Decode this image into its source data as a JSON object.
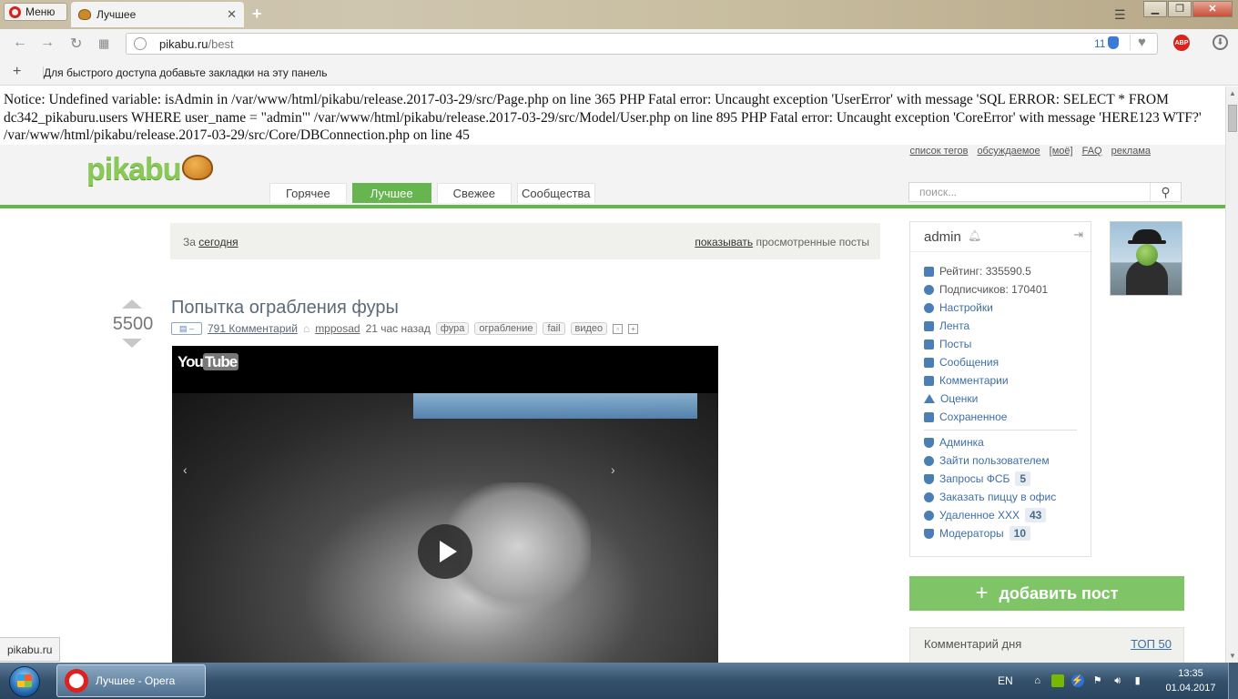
{
  "browser": {
    "menu_label": "Меню",
    "tab_title": "Лучшее",
    "tab_close": "✕",
    "new_tab": "+",
    "url_host": "pikabu.ru",
    "url_path": "/best",
    "blocked_count": "11",
    "bookmarks_plus": "+",
    "bookmarks_hint": "Для быстрого доступа добавьте закладки на эту панель",
    "abp_label": "ABP"
  },
  "error_text": "Notice: Undefined variable: isAdmin in /var/www/html/pikabu/release.2017-03-29/src/Page.php on line 365 PHP Fatal error: Uncaught exception 'UserError' with message 'SQL ERROR: SELECT * FROM dc342_pikaburu.users WHERE user_name = \"admin\"' /var/www/html/pikabu/release.2017-03-29/src/Model/User.php on line 895 PHP Fatal error: Uncaught exception 'CoreError' with message 'HERE123 WTF?' /var/www/html/pikabu/release.2017-03-29/src/Core/DBConnection.php on line 45",
  "header": {
    "logo": "pikabu",
    "top_links": [
      "список тегов",
      "обсуждаемое",
      "[моё]",
      "FAQ",
      "реклама"
    ],
    "tabs": [
      {
        "label": "Горячее",
        "active": false
      },
      {
        "label": "Лучшее",
        "active": true
      },
      {
        "label": "Свежее",
        "active": false
      },
      {
        "label": "Сообщества",
        "active": false
      }
    ],
    "search_placeholder": "поиск..."
  },
  "filter": {
    "prefix": "За",
    "period": "сегодня",
    "show_link": "показывать",
    "show_rest": "просмотренные посты"
  },
  "post": {
    "rating": "5500",
    "title": "Попытка ограбления фуры",
    "comments": "791 Комментарий",
    "author": "mpposad",
    "time": "21 час назад",
    "tags": [
      "фура",
      "ограбление",
      "fail",
      "видео"
    ],
    "video_brand": "You",
    "video_brand_box": "Tube"
  },
  "sidebar": {
    "username": "admin",
    "stats": [
      {
        "label": "Рейтинг: 335590.5",
        "icon": "chart-icon"
      },
      {
        "label": "Подписчиков: 170401",
        "icon": "user-icon"
      }
    ],
    "links": [
      {
        "label": "Настройки",
        "icon": "gear-icon"
      },
      {
        "label": "Лента",
        "icon": "feed-icon"
      },
      {
        "label": "Посты",
        "icon": "posts-icon"
      },
      {
        "label": "Сообщения",
        "icon": "messages-icon"
      },
      {
        "label": "Комментарии",
        "icon": "comments-icon"
      },
      {
        "label": "Оценки",
        "icon": "votes-icon"
      },
      {
        "label": "Сохраненное",
        "icon": "save-icon"
      }
    ],
    "admin_links": [
      {
        "label": "Админка",
        "icon": "shield-icon",
        "count": ""
      },
      {
        "label": "Зайти пользователем",
        "icon": "user-icon",
        "count": ""
      },
      {
        "label": "Запросы ФСБ",
        "icon": "shield-icon",
        "count": "5"
      },
      {
        "label": "Заказать пиццу в офис",
        "icon": "pizza-icon",
        "count": ""
      },
      {
        "label": "Удаленное ХХХ",
        "icon": "trash-icon",
        "count": "43"
      },
      {
        "label": "Модераторы",
        "icon": "shield-icon",
        "count": "10"
      }
    ]
  },
  "add_post": {
    "plus": "+",
    "label": "добавить пост"
  },
  "comment_day": {
    "title": "Комментарий дня",
    "top": "ТОП 50"
  },
  "status_tip": "pikabu.ru",
  "taskbar": {
    "task_label": "Лучшее - Opera",
    "lang": "EN",
    "time": "13:35",
    "date": "01.04.2017"
  }
}
